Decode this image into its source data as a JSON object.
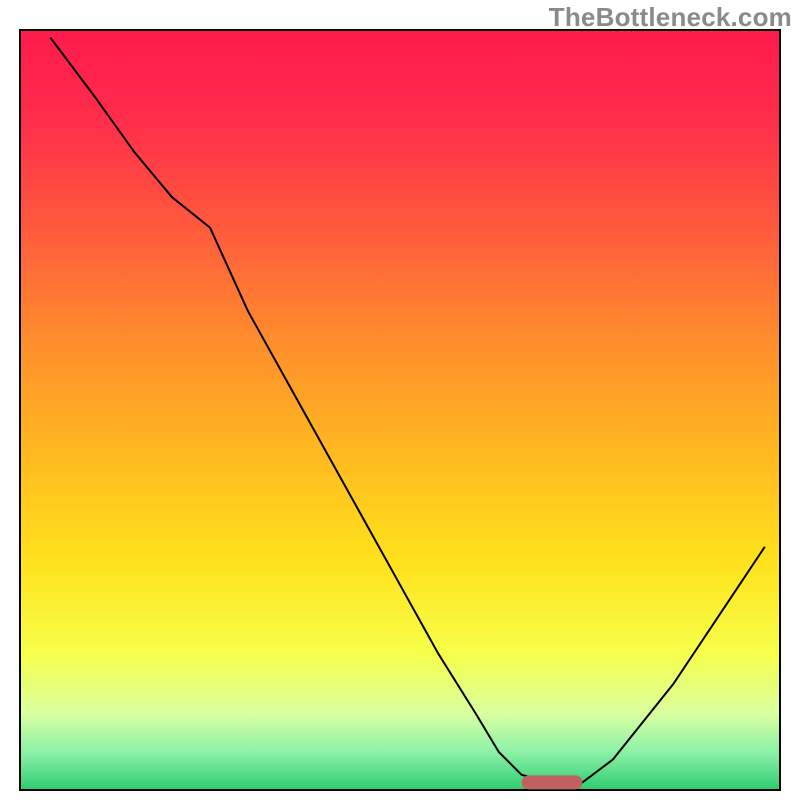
{
  "watermark": "TheBottleneck.com",
  "chart_data": {
    "type": "line",
    "title": "",
    "xlabel": "",
    "ylabel": "",
    "xlim": [
      0,
      100
    ],
    "ylim": [
      0,
      100
    ],
    "grid": false,
    "legend": false,
    "series": [
      {
        "name": "bottleneck-curve",
        "x": [
          4,
          10,
          15,
          20,
          25,
          30,
          35,
          40,
          45,
          50,
          55,
          60,
          63,
          66,
          70,
          74,
          78,
          82,
          86,
          90,
          94,
          98
        ],
        "y": [
          99,
          91,
          84,
          78,
          74,
          63,
          54,
          45,
          36,
          27,
          18,
          10,
          5,
          2,
          1,
          1,
          4,
          9,
          14,
          20,
          26,
          32
        ]
      }
    ],
    "marker": {
      "name": "optimal-point",
      "x_start": 66,
      "x_end": 74,
      "y": 1,
      "color": "#c16060"
    },
    "gradient_stops": [
      {
        "pos": 0.0,
        "color": "#ff1a4d"
      },
      {
        "pos": 0.12,
        "color": "#ff2e4a"
      },
      {
        "pos": 0.26,
        "color": "#ff5a3d"
      },
      {
        "pos": 0.4,
        "color": "#ff8a2e"
      },
      {
        "pos": 0.55,
        "color": "#ffb720"
      },
      {
        "pos": 0.7,
        "color": "#ffe21c"
      },
      {
        "pos": 0.82,
        "color": "#f7ff4a"
      },
      {
        "pos": 0.9,
        "color": "#d9ffa0"
      },
      {
        "pos": 0.95,
        "color": "#8cf2a8"
      },
      {
        "pos": 1.0,
        "color": "#2ecc71"
      }
    ],
    "frame_color": "#000000",
    "curve_color": "#000000",
    "curve_width": 2
  }
}
